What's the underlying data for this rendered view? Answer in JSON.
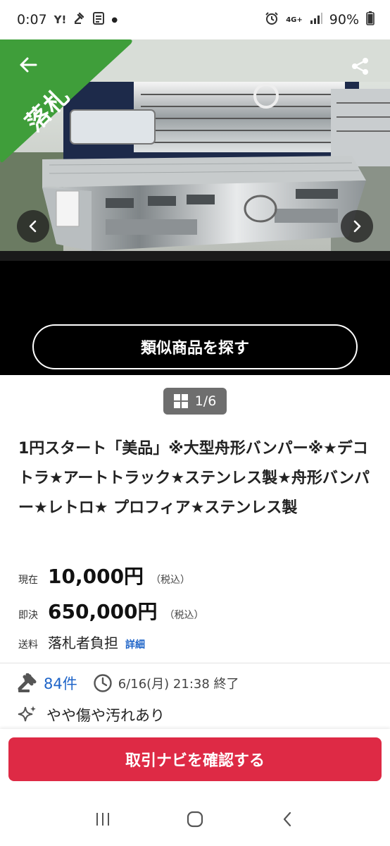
{
  "status_bar": {
    "time": "0:07",
    "network": "4G+",
    "battery": "90%",
    "icons": [
      "yahoo-icon",
      "auction-icon",
      "news-icon",
      "alarm-icon",
      "signal-icon",
      "battery-icon"
    ]
  },
  "image_viewer": {
    "sold_badge": "落札",
    "similar_button": "類似商品を探す",
    "counter": "1/6"
  },
  "item": {
    "title": "1円スタート「美品」※大型舟形バンパー※★デコトラ★アートトラック★ステンレス製★舟形バンパー★レトロ★ プロフィア★ステンレス製",
    "current_label": "現在",
    "current_price": "10,000円",
    "current_tax": "（税込）",
    "buyout_label": "即決",
    "buyout_price": "650,000円",
    "buyout_tax": "（税込）",
    "shipping_label": "送料",
    "shipping_value": "落札者負担",
    "shipping_detail": "詳細",
    "bid_count": "84件",
    "end_time": "6/16(月) 21:38 終了",
    "condition": "やや傷や汚れあり"
  },
  "bottom": {
    "confirm_button": "取引ナビを確認する"
  },
  "colors": {
    "sold_green": "#3f9e3a",
    "accent_blue": "#1e64c8",
    "confirm_red": "#de2a45",
    "counter_gray": "#6e6e6e"
  }
}
